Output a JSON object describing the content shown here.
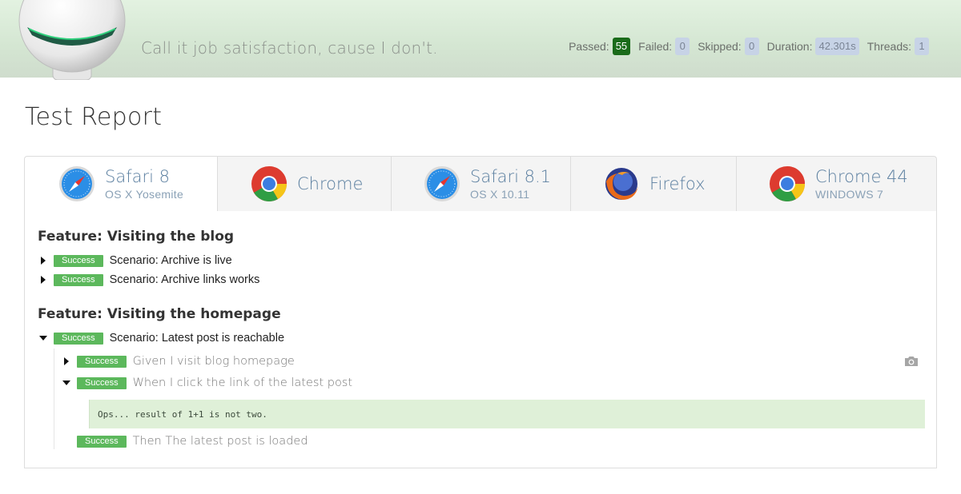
{
  "header": {
    "tagline": "Call it job satisfaction, cause I don't.",
    "stats": {
      "passed_label": "Passed:",
      "passed_value": "55",
      "failed_label": "Failed:",
      "failed_value": "0",
      "skipped_label": "Skipped:",
      "skipped_value": "0",
      "duration_label": "Duration:",
      "duration_value": "42.301s",
      "threads_label": "Threads:",
      "threads_value": "1"
    }
  },
  "page": {
    "title": "Test Report"
  },
  "tabs": [
    {
      "name": "Safari 8",
      "os": "OS X Yosemite",
      "icon": "safari-icon"
    },
    {
      "name": "Chrome",
      "os": "",
      "icon": "chrome-icon"
    },
    {
      "name": "Safari 8.1",
      "os": "OS X 10.11",
      "icon": "safari-icon"
    },
    {
      "name": "Firefox",
      "os": "",
      "icon": "firefox-icon"
    },
    {
      "name": "Chrome 44",
      "os": "WINDOWS 7",
      "icon": "chrome-icon"
    }
  ],
  "features": [
    {
      "title": "Feature: Visiting the blog",
      "scenarios": [
        {
          "status": "Success",
          "text": "Scenario: Archive is live"
        },
        {
          "status": "Success",
          "text": "Scenario: Archive links works"
        }
      ]
    },
    {
      "title": "Feature: Visiting the homepage",
      "scenarios": [
        {
          "status": "Success",
          "text": "Scenario: Latest post is reachable",
          "steps": [
            {
              "status": "Success",
              "text": "Given I visit blog homepage"
            },
            {
              "status": "Success",
              "text": "When I click the link of the latest post",
              "output": "Ops... result of 1+1 is not two."
            },
            {
              "status": "Success",
              "text": "Then The latest post is loaded"
            }
          ]
        }
      ]
    }
  ],
  "colors": {
    "success": "#5cb85c",
    "passed_badge": "#1a6b1a",
    "tab_text": "#5b7fa0",
    "header_bg": "#e3f2e1"
  }
}
